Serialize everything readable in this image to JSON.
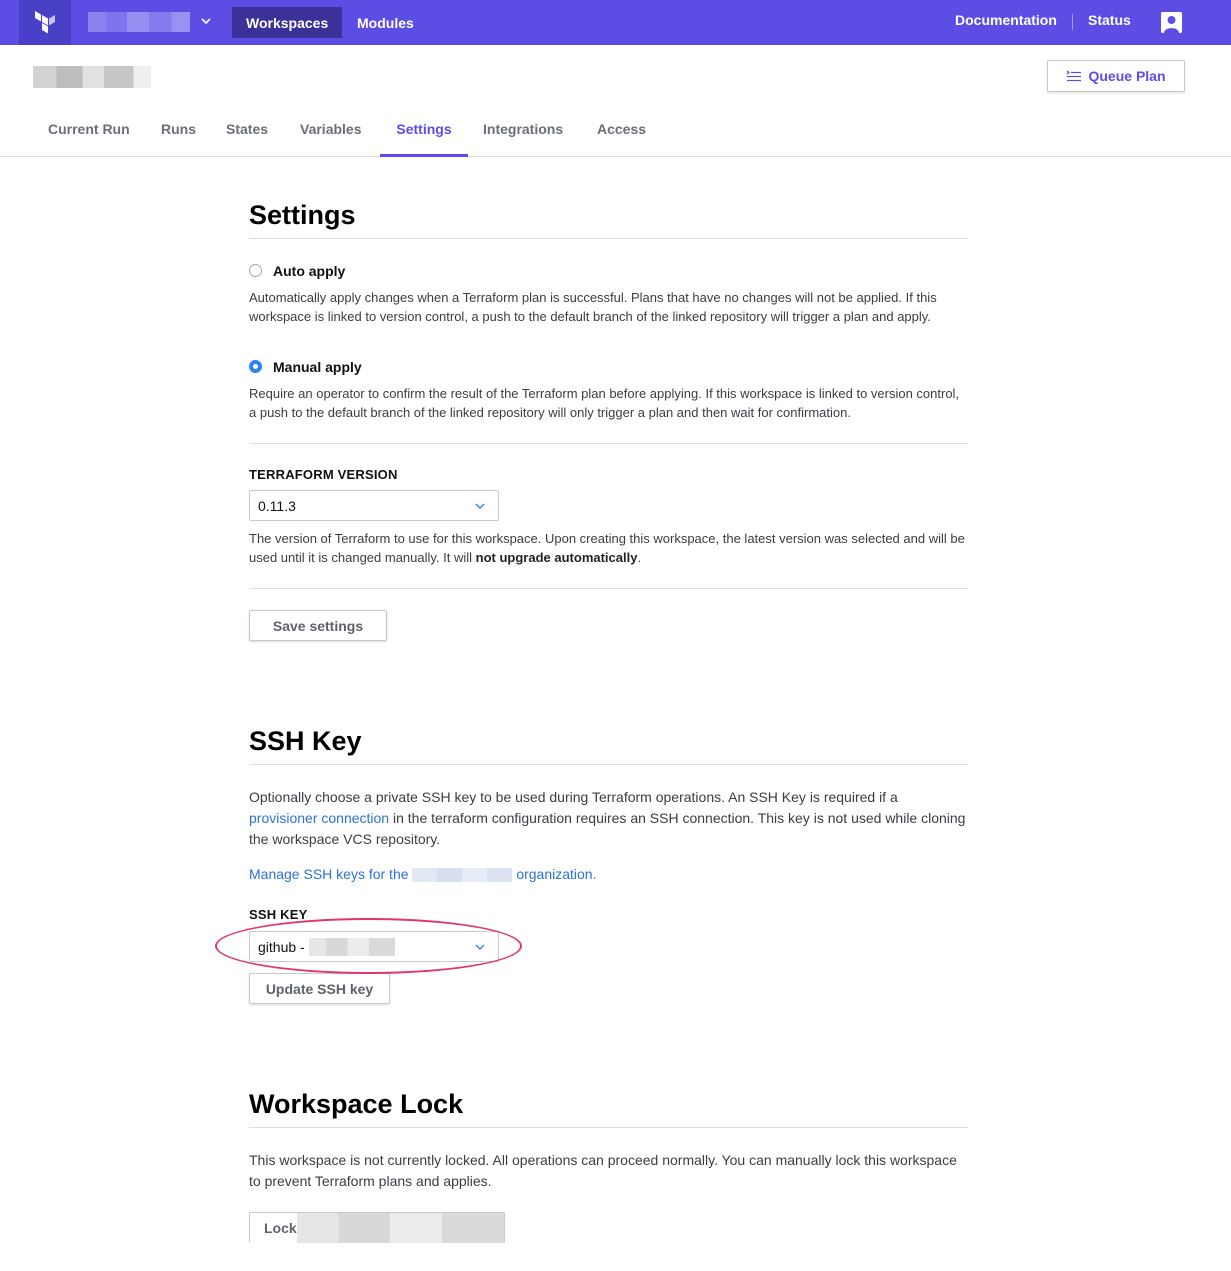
{
  "topnav": {
    "tabs": [
      "Workspaces",
      "Modules"
    ],
    "links": {
      "documentation": "Documentation",
      "status": "Status"
    }
  },
  "header": {
    "queue_plan_label": "Queue Plan",
    "tabs": [
      "Current Run",
      "Runs",
      "States",
      "Variables",
      "Settings",
      "Integrations",
      "Access"
    ],
    "active_tab": "Settings"
  },
  "settings": {
    "title": "Settings",
    "auto_apply": {
      "label": "Auto apply",
      "description": "Automatically apply changes when a Terraform plan is successful. Plans that have no changes will not be applied. If this workspace is linked to version control, a push to the default branch of the linked repository will trigger a plan and apply.",
      "checked": false
    },
    "manual_apply": {
      "label": "Manual apply",
      "description": "Require an operator to confirm the result of the Terraform plan before applying. If this workspace is linked to version control, a push to the default branch of the linked repository will only trigger a plan and then wait for confirmation.",
      "checked": true
    },
    "version_label": "TERRAFORM VERSION",
    "version_value": "0.11.3",
    "version_help_prefix": "The version of Terraform to use for this workspace. Upon creating this workspace, the latest version was selected and will be used until it is changed manually. It will ",
    "version_help_bold": "not upgrade automatically",
    "version_help_suffix": ".",
    "save_label": "Save settings"
  },
  "ssh": {
    "title": "SSH Key",
    "desc_prefix": "Optionally choose a private SSH key to be used during Terraform operations. An SSH Key is required if a ",
    "desc_link": "provisioner connection",
    "desc_suffix": " in the terraform configuration requires an SSH connection. This key is not used while cloning the workspace VCS repository.",
    "manage_prefix": "Manage SSH keys for the",
    "manage_suffix": "organization.",
    "field_label": "SSH KEY",
    "select_value": "github -",
    "update_label": "Update SSH key",
    "annotation_color": "#e0386c"
  },
  "lock": {
    "title": "Workspace Lock",
    "description": "This workspace is not currently locked. All operations can proceed normally. You can manually lock this workspace to prevent Terraform plans and applies.",
    "lock_label": "Lock"
  },
  "colors": {
    "brand": "#5c4ee5",
    "link": "#2f71d4",
    "radio": "#2f82f5"
  }
}
